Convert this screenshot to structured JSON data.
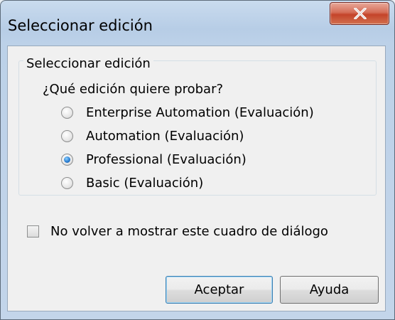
{
  "window": {
    "title": "Seleccionar edición",
    "close_icon": "close-icon"
  },
  "group": {
    "legend": "Seleccionar edición",
    "question": "¿Qué edición quiere probar?",
    "options": [
      {
        "label": "Enterprise Automation (Evaluación)",
        "selected": false
      },
      {
        "label": "Automation (Evaluación)",
        "selected": false
      },
      {
        "label": "Professional (Evaluación)",
        "selected": true
      },
      {
        "label": "Basic (Evaluación)",
        "selected": false
      }
    ]
  },
  "dont_show": {
    "label": "No volver a mostrar este cuadro de diálogo",
    "checked": false
  },
  "buttons": {
    "accept": "Aceptar",
    "help": "Ayuda"
  },
  "colors": {
    "close_button": "#c4442a",
    "frame": "#b7cde6",
    "client": "#f0f0f0",
    "radio_selected": "#2b7fd1"
  }
}
